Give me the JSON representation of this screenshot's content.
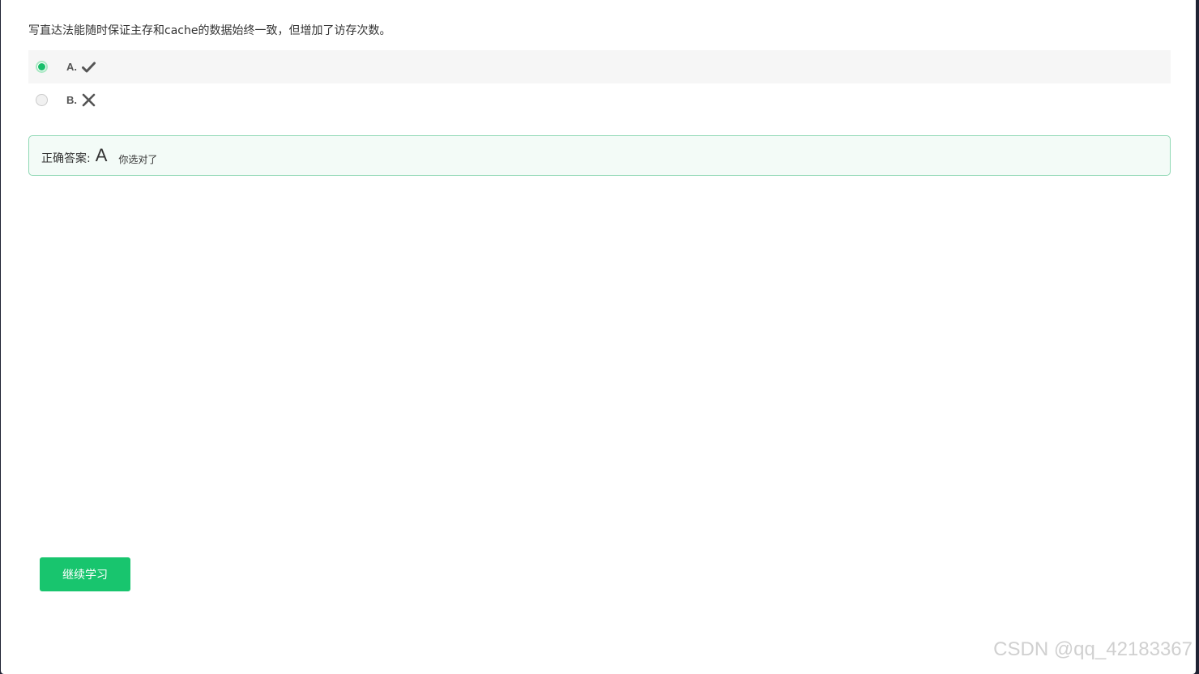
{
  "question": {
    "text": "写直达法能随时保证主存和cache的数据始终一致，但增加了访存次数。"
  },
  "options": [
    {
      "letter": "A.",
      "icon": "check-icon",
      "selected": true
    },
    {
      "letter": "B.",
      "icon": "cross-icon",
      "selected": false
    }
  ],
  "answer": {
    "label": "正确答案:",
    "value": "A",
    "result": "你选对了"
  },
  "continue_button": {
    "label": "继续学习"
  },
  "watermark": {
    "text": "CSDN @qq_42183367"
  },
  "colors": {
    "accent_green": "#19be6b",
    "button_green": "#18c56e",
    "answer_border": "#8fd8b4",
    "answer_bg": "#f3fbf7"
  }
}
